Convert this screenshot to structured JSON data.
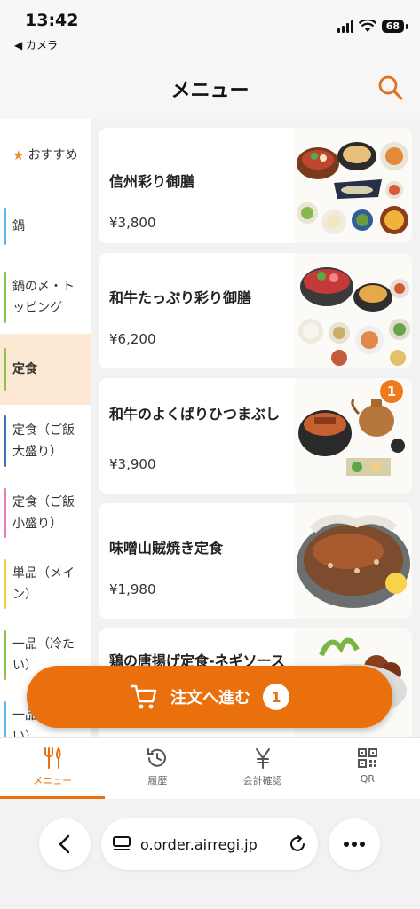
{
  "status_bar": {
    "time": "13:42",
    "back_label": "◀ カメラ",
    "battery": "68"
  },
  "header": {
    "title": "メニュー"
  },
  "sidebar": {
    "recommended": "おすすめ",
    "items": [
      {
        "label": "鍋",
        "color": "#5bb5e8"
      },
      {
        "label": "鍋の〆・トッピング",
        "color": "#8bc34a"
      },
      {
        "label": "定食",
        "color": "#8bc34a"
      },
      {
        "label": "定食（ご飯大盛り）",
        "color": "#3f6fb6"
      },
      {
        "label": "定食（ご飯小盛り）",
        "color": "#e57bbf"
      },
      {
        "label": "単品（メイン）",
        "color": "#f5d03b"
      },
      {
        "label": "一品（冷たい）",
        "color": "#8bc34a"
      },
      {
        "label": "一品（温かい）",
        "color": "#5bb5e8"
      }
    ],
    "active_index": 2
  },
  "menu_items": [
    {
      "name": "信州彩り御膳",
      "price": "¥3,800",
      "badge": ""
    },
    {
      "name": "和牛たっぷり彩り御膳",
      "price": "¥6,200",
      "badge": ""
    },
    {
      "name": "和牛のよくばりひつまぶし",
      "price": "¥3,900",
      "badge": "1"
    },
    {
      "name": "味噌山賊焼き定食",
      "price": "¥1,980",
      "badge": ""
    },
    {
      "name": "鶏の唐揚げ定食-ネギソース",
      "price": "",
      "badge": ""
    }
  ],
  "order_button": {
    "label": "注文へ進む",
    "count": "1"
  },
  "tabs": [
    {
      "label": "メニュー",
      "icon": "fork-knife-icon",
      "active": true
    },
    {
      "label": "履歴",
      "icon": "history-icon",
      "active": false
    },
    {
      "label": "会計確認",
      "icon": "yen-icon",
      "active": false
    },
    {
      "label": "QR",
      "icon": "qr-icon",
      "active": false
    }
  ],
  "browser": {
    "url": "o.order.airregi.jp"
  },
  "colors": {
    "accent": "#ea700e",
    "active_bg": "#fde8d4"
  }
}
